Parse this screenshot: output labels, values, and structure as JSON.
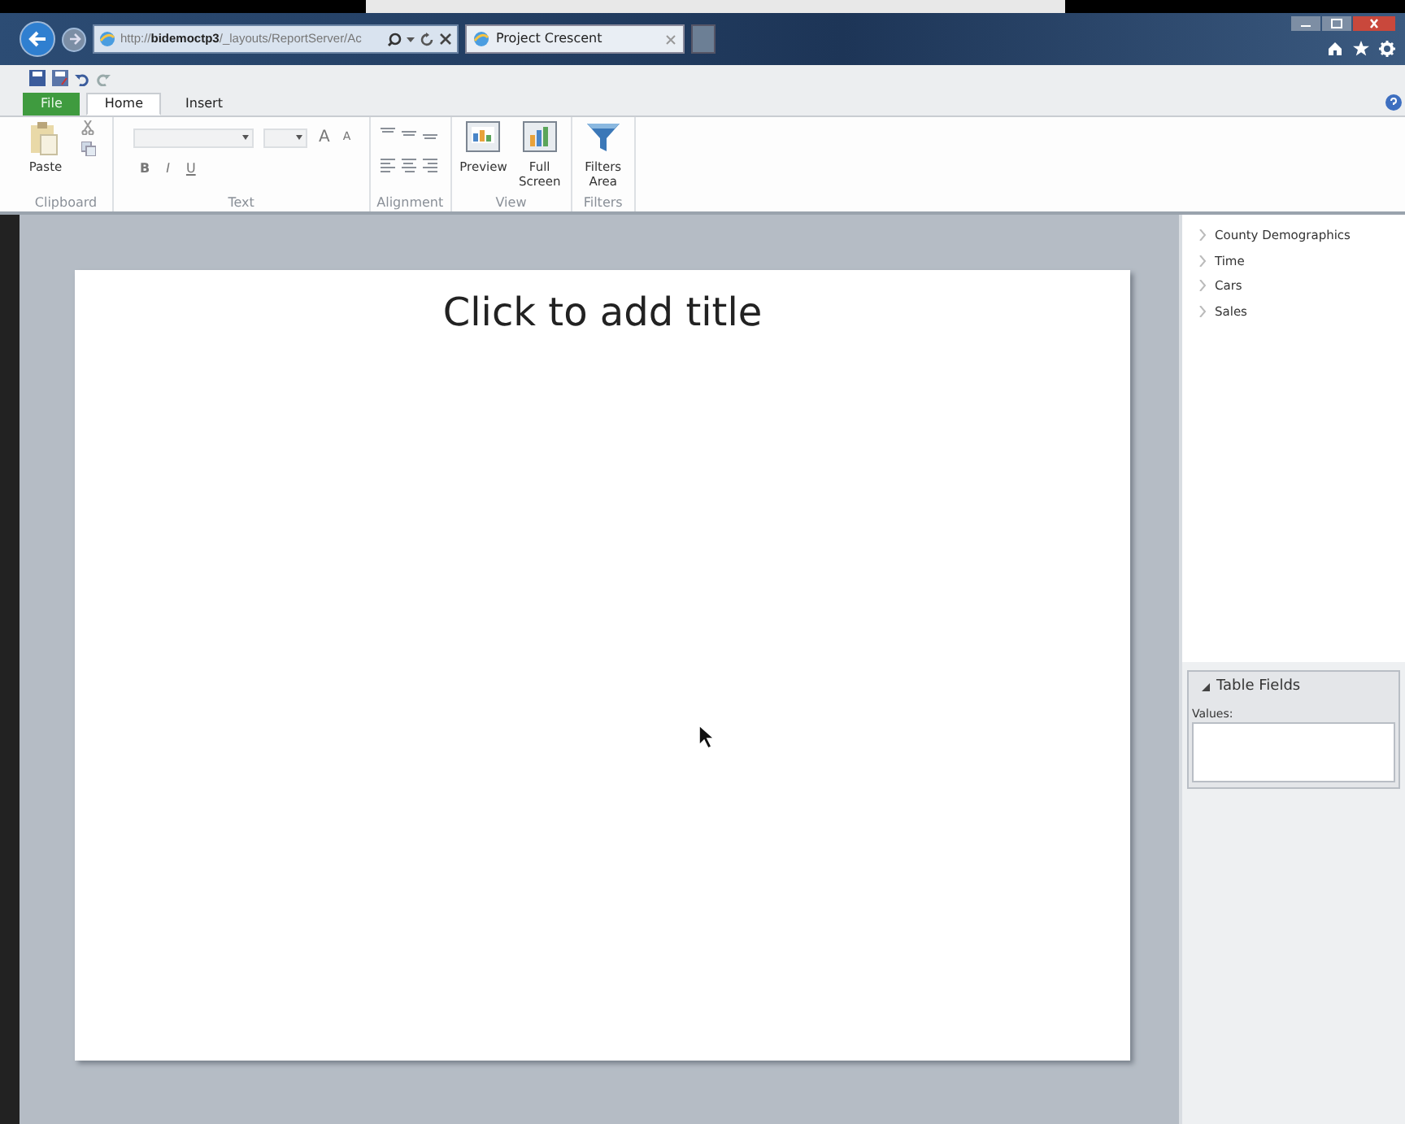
{
  "browser": {
    "address": "http://bidemoctp3/_layouts/ReportServer/Ac",
    "tabs": [
      {
        "label": "Project Crescent",
        "selected": true
      }
    ]
  },
  "ribbon": {
    "tabs": [
      {
        "label": "File",
        "kind": "file",
        "selected": false
      },
      {
        "label": "Home",
        "kind": "tab",
        "selected": true
      },
      {
        "label": "Insert",
        "kind": "tab",
        "selected": false
      }
    ],
    "groups": [
      {
        "label": "Clipboard",
        "kind": "clipboard",
        "buttons": [
          {
            "label": "Paste"
          }
        ]
      },
      {
        "label": "Text",
        "kind": "text",
        "format": [
          "B",
          "I",
          "U"
        ],
        "size_glyphs": [
          "A",
          "A"
        ]
      },
      {
        "label": "Alignment",
        "kind": "alignment"
      },
      {
        "label": "View",
        "kind": "buttons",
        "buttons": [
          {
            "label": "Preview"
          },
          {
            "label": "Full Screen"
          }
        ]
      },
      {
        "label": "Filters",
        "kind": "buttons",
        "buttons": [
          {
            "label": "Filters Area"
          }
        ]
      }
    ]
  },
  "slide": {
    "title_placeholder": "Click to add title"
  },
  "field_list": {
    "items": [
      {
        "label": "County Demographics",
        "expanded": false
      },
      {
        "label": "Time",
        "expanded": false
      },
      {
        "label": "Cars",
        "expanded": false
      },
      {
        "label": "Sales",
        "expanded": false
      }
    ]
  },
  "table_fields": {
    "title": "Table Fields",
    "expanded": true,
    "values_label": "Values:"
  }
}
